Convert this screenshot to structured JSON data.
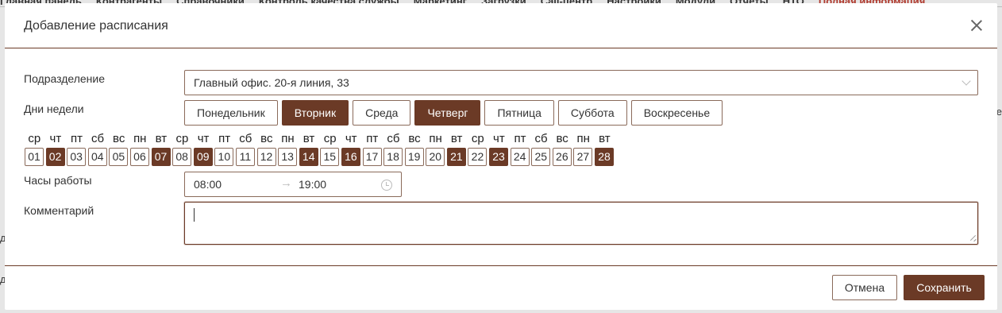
{
  "background": {
    "menu": [
      {
        "label": "Главная панель",
        "red": false
      },
      {
        "label": "Контрагенты",
        "red": false
      },
      {
        "label": "Справочники",
        "red": false
      },
      {
        "label": "Контроль качества службы",
        "red": false
      },
      {
        "label": "Маркетинг",
        "red": false
      },
      {
        "label": "Загрузки",
        "red": false
      },
      {
        "label": "Call-центр",
        "red": false
      },
      {
        "label": "Настройки",
        "red": false
      },
      {
        "label": "Модули",
        "red": false
      },
      {
        "label": "Отчеты",
        "red": false
      },
      {
        "label": "НТО",
        "red": false
      },
      {
        "label": "Полная информация",
        "red": true
      }
    ]
  },
  "colors": {
    "accent": "#6b3a26",
    "border": "#8a6a5a"
  },
  "modal": {
    "title": "Добавление расписания",
    "close_icon": "close-icon",
    "fields": {
      "department_label": "Подразделение",
      "department_value": "Главный офис. 20-я линия, 33",
      "weekdays_label": "Дни недели",
      "hours_label": "Часы работы",
      "comment_label": "Комментарий"
    },
    "weekdays": [
      {
        "label": "Понедельник",
        "active": false
      },
      {
        "label": "Вторник",
        "active": true
      },
      {
        "label": "Среда",
        "active": false
      },
      {
        "label": "Четверг",
        "active": true
      },
      {
        "label": "Пятница",
        "active": false
      },
      {
        "label": "Суббота",
        "active": false
      },
      {
        "label": "Воскресенье",
        "active": false
      }
    ],
    "calendar": {
      "weekday_headers": [
        "ср",
        "чт",
        "пт",
        "сб",
        "вс",
        "пн",
        "вт",
        "ср",
        "чт",
        "пт",
        "сб",
        "вс",
        "пн",
        "вт",
        "ср",
        "чт",
        "пт",
        "сб",
        "вс",
        "пн",
        "вт",
        "ср",
        "чт",
        "пт",
        "сб",
        "вс",
        "пн",
        "вт"
      ],
      "days": [
        {
          "d": "01",
          "active": false
        },
        {
          "d": "02",
          "active": true
        },
        {
          "d": "03",
          "active": false
        },
        {
          "d": "04",
          "active": false
        },
        {
          "d": "05",
          "active": false
        },
        {
          "d": "06",
          "active": false
        },
        {
          "d": "07",
          "active": true
        },
        {
          "d": "08",
          "active": false
        },
        {
          "d": "09",
          "active": true
        },
        {
          "d": "10",
          "active": false
        },
        {
          "d": "11",
          "active": false
        },
        {
          "d": "12",
          "active": false
        },
        {
          "d": "13",
          "active": false
        },
        {
          "d": "14",
          "active": true
        },
        {
          "d": "15",
          "active": false
        },
        {
          "d": "16",
          "active": true
        },
        {
          "d": "17",
          "active": false
        },
        {
          "d": "18",
          "active": false
        },
        {
          "d": "19",
          "active": false
        },
        {
          "d": "20",
          "active": false
        },
        {
          "d": "21",
          "active": true
        },
        {
          "d": "22",
          "active": false
        },
        {
          "d": "23",
          "active": true
        },
        {
          "d": "24",
          "active": false
        },
        {
          "d": "25",
          "active": false
        },
        {
          "d": "26",
          "active": false
        },
        {
          "d": "27",
          "active": false
        },
        {
          "d": "28",
          "active": true
        }
      ]
    },
    "hours": {
      "from": "08:00",
      "arrow": "→",
      "to": "19:00"
    },
    "comment_value": "",
    "buttons": {
      "cancel": "Отмена",
      "save": "Сохранить"
    }
  }
}
